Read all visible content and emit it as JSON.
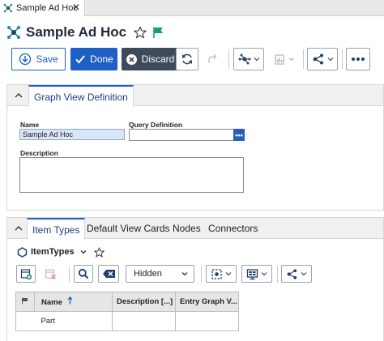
{
  "tab": {
    "label": "Sample Ad Hoc"
  },
  "header": {
    "title": "Sample Ad Hoc"
  },
  "toolbar": {
    "save": "Save",
    "done": "Done",
    "discard": "Discard"
  },
  "definition_panel": {
    "tab": "Graph View Definition",
    "name_label": "Name",
    "name_value": "Sample Ad Hoc",
    "query_label": "Query Definition",
    "query_value": "",
    "query_button": "•••",
    "description_label": "Description",
    "description_value": ""
  },
  "tabs_panel": {
    "tabs": [
      "Item Types",
      "Default View Cards",
      "Nodes",
      "Connectors"
    ],
    "itemtypes_label": "ItemTypes",
    "filter_value": "Hidden",
    "grid": {
      "columns": [
        "Name",
        "Description [...]",
        "Entry Graph V..."
      ],
      "rows": [
        [
          "Part",
          "",
          ""
        ]
      ]
    }
  },
  "colors": {
    "accent": "#1d5fc2",
    "discard": "#3d4a5a",
    "flag": "#159a7c"
  }
}
